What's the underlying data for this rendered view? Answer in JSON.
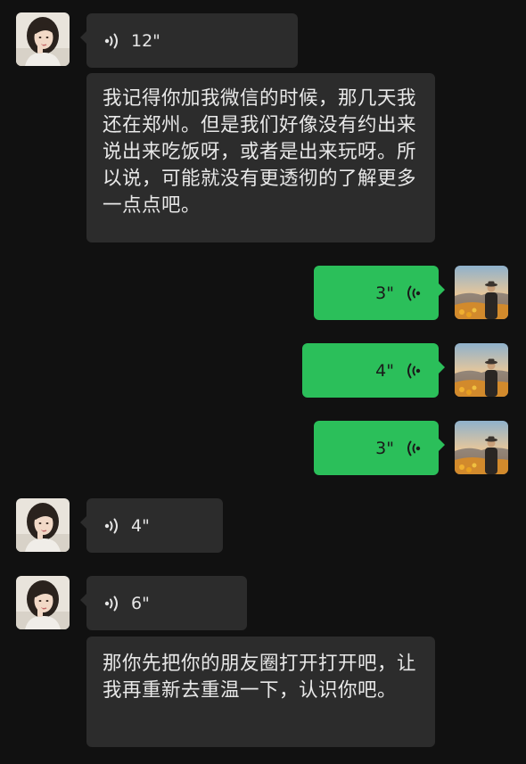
{
  "messages": [
    {
      "side": "in",
      "kind": "voice",
      "duration": "12\""
    },
    {
      "side": "in",
      "kind": "text",
      "text": "我记得你加我微信的时候，那几天我还在郑州。但是我们好像没有约出来说出来吃饭呀，或者是出来玩呀。所以说，可能就没有更透彻的了解更多一点点吧。"
    },
    {
      "side": "out",
      "kind": "voice",
      "duration": "3\""
    },
    {
      "side": "out",
      "kind": "voice",
      "duration": "4\""
    },
    {
      "side": "out",
      "kind": "voice",
      "duration": "3\""
    },
    {
      "side": "in",
      "kind": "voice",
      "duration": "4\""
    },
    {
      "side": "in",
      "kind": "voice",
      "duration": "6\""
    },
    {
      "side": "in",
      "kind": "text",
      "text": "那你先把你的朋友圈打开打开吧，让我再重新去重温一下，认识你吧。"
    }
  ],
  "icons": {
    "incoming_voice": "voice-wave-icon",
    "outgoing_voice": "voice-wave-icon"
  },
  "colors": {
    "background": "#111111",
    "incoming_bubble": "#2c2c2c",
    "outgoing_bubble": "#2bbf5a"
  }
}
